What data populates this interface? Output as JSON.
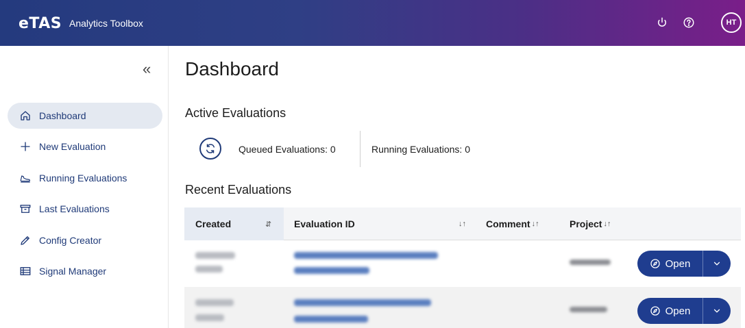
{
  "header": {
    "logo": "eTAS",
    "app_name": "Analytics Toolbox",
    "icons": [
      "power-icon",
      "help-icon"
    ],
    "avatar_initials": "HT"
  },
  "sidebar": {
    "collapse_glyph": "«",
    "items": [
      {
        "label": "Dashboard",
        "icon": "home-icon",
        "active": true
      },
      {
        "label": "New Evaluation",
        "icon": "plus-icon"
      },
      {
        "label": "Running Evaluations",
        "icon": "running-shoe-icon"
      },
      {
        "label": "Last Evaluations",
        "icon": "archive-box-icon"
      },
      {
        "label": "Config Creator",
        "icon": "pencil-icon"
      },
      {
        "label": "Signal Manager",
        "icon": "table-icon"
      }
    ]
  },
  "main": {
    "title": "Dashboard",
    "active_title": "Active Evaluations",
    "queued": "Queued Evaluations: 0",
    "running": "Running Evaluations: 0",
    "recent_title": "Recent Evaluations",
    "columns": {
      "created": "Created",
      "evaluation_id": "Evaluation ID",
      "comment": "Comment",
      "project": "Project",
      "sort_glyph": "↓↑",
      "sorted_glyph": "⇵"
    },
    "row_action": {
      "label": "Open"
    }
  },
  "colors": {
    "header_start": "#243a7e",
    "header_end": "#7a1e89",
    "accent": "#1f3d8f",
    "nav_active_bg": "#e4e9f1"
  }
}
